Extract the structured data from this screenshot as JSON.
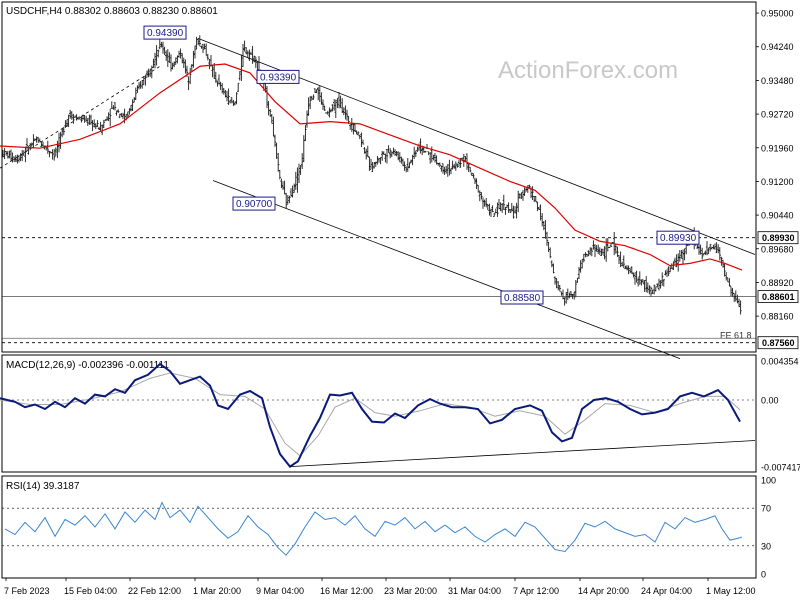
{
  "header": {
    "symbol_line": "USDCHF,H4  0.88302 0.88603 0.88230 0.88601"
  },
  "watermark": "ActionForex.com",
  "colors": {
    "candle": "#1a1a1a",
    "ma": "#e00000",
    "macd_line": "#0a1a7a",
    "macd_signal": "#a8a8a8",
    "rsi": "#3a86d4",
    "label_box": "#1a1a8c",
    "watermark": "#c8c8c8"
  },
  "chart_data": [
    {
      "type": "candlestick",
      "name": "price",
      "ylim": [
        0.8735,
        0.9525
      ],
      "y_ticks": [
        "0.95000",
        "0.94240",
        "0.93480",
        "0.92720",
        "0.91960",
        "0.91200",
        "0.90440",
        "0.89680",
        "0.88920",
        "0.88160"
      ],
      "x_ticks": [
        "7 Feb 2023",
        "15 Feb 04:00",
        "22 Feb 12:00",
        "1 Mar 20:00",
        "9 Mar 04:00",
        "16 Mar 12:00",
        "23 Mar 20:00",
        "31 Mar 04:00",
        "7 Apr 12:00",
        "14 Apr 20:00",
        "24 Apr 04:00",
        "1 May 12:00"
      ],
      "path_points": [
        [
          0,
          0.919
        ],
        [
          18,
          0.917
        ],
        [
          38,
          0.9215
        ],
        [
          56,
          0.918
        ],
        [
          70,
          0.927
        ],
        [
          90,
          0.9255
        ],
        [
          102,
          0.924
        ],
        [
          115,
          0.929
        ],
        [
          127,
          0.926
        ],
        [
          140,
          0.933
        ],
        [
          152,
          0.938
        ],
        [
          163,
          0.943
        ],
        [
          172,
          0.938
        ],
        [
          182,
          0.941
        ],
        [
          190,
          0.935
        ],
        [
          198,
          0.9439
        ],
        [
          206,
          0.942
        ],
        [
          215,
          0.936
        ],
        [
          225,
          0.932
        ],
        [
          236,
          0.929
        ],
        [
          245,
          0.942
        ],
        [
          256,
          0.94
        ],
        [
          265,
          0.9339
        ],
        [
          273,
          0.926
        ],
        [
          281,
          0.913
        ],
        [
          288,
          0.907
        ],
        [
          295,
          0.911
        ],
        [
          303,
          0.916
        ],
        [
          310,
          0.93
        ],
        [
          318,
          0.933
        ],
        [
          328,
          0.927
        ],
        [
          340,
          0.93
        ],
        [
          352,
          0.925
        ],
        [
          362,
          0.922
        ],
        [
          372,
          0.915
        ],
        [
          383,
          0.918
        ],
        [
          395,
          0.919
        ],
        [
          408,
          0.915
        ],
        [
          420,
          0.92
        ],
        [
          432,
          0.918
        ],
        [
          444,
          0.915
        ],
        [
          456,
          0.915
        ],
        [
          466,
          0.9175
        ],
        [
          476,
          0.912
        ],
        [
          486,
          0.907
        ],
        [
          495,
          0.9045
        ],
        [
          505,
          0.907
        ],
        [
          515,
          0.9045
        ],
        [
          522,
          0.909
        ],
        [
          530,
          0.911
        ],
        [
          540,
          0.906
        ],
        [
          549,
          0.898
        ],
        [
          556,
          0.89
        ],
        [
          565,
          0.8858
        ],
        [
          575,
          0.887
        ],
        [
          584,
          0.8945
        ],
        [
          594,
          0.897
        ],
        [
          604,
          0.896
        ],
        [
          614,
          0.898
        ],
        [
          624,
          0.893
        ],
        [
          634,
          0.891
        ],
        [
          644,
          0.889
        ],
        [
          654,
          0.887
        ],
        [
          664,
          0.89
        ],
        [
          674,
          0.893
        ],
        [
          684,
          0.896
        ],
        [
          694,
          0.8993
        ],
        [
          704,
          0.895
        ],
        [
          713,
          0.8975
        ],
        [
          720,
          0.8965
        ],
        [
          728,
          0.89
        ],
        [
          735,
          0.886
        ],
        [
          742,
          0.8835
        ]
      ],
      "moving_average": [
        [
          0,
          0.92
        ],
        [
          40,
          0.9195
        ],
        [
          80,
          0.9215
        ],
        [
          120,
          0.925
        ],
        [
          160,
          0.932
        ],
        [
          200,
          0.938
        ],
        [
          225,
          0.9385
        ],
        [
          250,
          0.9365
        ],
        [
          275,
          0.93
        ],
        [
          300,
          0.925
        ],
        [
          330,
          0.9255
        ],
        [
          360,
          0.925
        ],
        [
          390,
          0.9225
        ],
        [
          420,
          0.92
        ],
        [
          450,
          0.918
        ],
        [
          480,
          0.915
        ],
        [
          510,
          0.912
        ],
        [
          535,
          0.91
        ],
        [
          555,
          0.906
        ],
        [
          575,
          0.901
        ],
        [
          600,
          0.8985
        ],
        [
          625,
          0.8975
        ],
        [
          650,
          0.8955
        ],
        [
          670,
          0.893
        ],
        [
          690,
          0.8935
        ],
        [
          710,
          0.8945
        ],
        [
          725,
          0.8935
        ],
        [
          742,
          0.892
        ]
      ],
      "channel_upper": [
        [
          198,
          0.9443
        ],
        [
          755,
          0.8955
        ]
      ],
      "channel_lower": [
        [
          213,
          0.9122
        ],
        [
          680,
          0.872
        ]
      ],
      "trend_support": [
        [
          0,
          0.915
        ],
        [
          160,
          0.938
        ]
      ],
      "horizontal_levels": [
        {
          "value": 0.8993,
          "label": "0.89930",
          "style": "dashed"
        },
        {
          "value": 0.88601,
          "label": "0.88601",
          "style": "solid"
        },
        {
          "value": 0.8756,
          "label": "0.87560",
          "style": "dashed"
        },
        {
          "value": 0.8766,
          "style": "solid"
        }
      ],
      "price_labels": [
        {
          "text": "0.94390",
          "x": 165,
          "value": 0.9439
        },
        {
          "text": "0.93390",
          "x": 278,
          "value": 0.9339
        },
        {
          "text": "0.90700",
          "x": 254,
          "value": 0.907
        },
        {
          "text": "0.88580",
          "x": 522,
          "value": 0.8858
        },
        {
          "text": "0.89930",
          "x": 678,
          "value": 0.8993
        }
      ],
      "annotations": [
        {
          "text": "FE 61.8"
        }
      ]
    },
    {
      "type": "line",
      "name": "macd",
      "title": "MACD(12,26,9) -0.002396 -0.001111",
      "ylim": [
        -0.008,
        0.005
      ],
      "y_ticks": [
        "0.004354",
        "0.00",
        "-0.007417"
      ],
      "macd": [
        [
          0,
          0.0002
        ],
        [
          15,
          -0.0002
        ],
        [
          25,
          -0.0008
        ],
        [
          35,
          -0.0005
        ],
        [
          45,
          -0.001
        ],
        [
          55,
          -0.0002
        ],
        [
          65,
          -0.0008
        ],
        [
          75,
          0.0002
        ],
        [
          85,
          -0.0004
        ],
        [
          95,
          0.0006
        ],
        [
          105,
          0.0004
        ],
        [
          115,
          0.0012
        ],
        [
          125,
          0.0008
        ],
        [
          135,
          0.0022
        ],
        [
          148,
          0.0028
        ],
        [
          160,
          0.004
        ],
        [
          170,
          0.0032
        ],
        [
          180,
          0.0018
        ],
        [
          190,
          0.0022
        ],
        [
          200,
          0.0026
        ],
        [
          210,
          0.0016
        ],
        [
          218,
          -0.0006
        ],
        [
          228,
          -0.001
        ],
        [
          240,
          0.0006
        ],
        [
          250,
          0.001
        ],
        [
          262,
          0.0002
        ],
        [
          270,
          -0.003
        ],
        [
          280,
          -0.006
        ],
        [
          290,
          -0.0074
        ],
        [
          298,
          -0.0068
        ],
        [
          310,
          -0.004
        ],
        [
          320,
          -0.002
        ],
        [
          330,
          0.0006
        ],
        [
          340,
          0.0005
        ],
        [
          352,
          0.0008
        ],
        [
          362,
          -0.001
        ],
        [
          372,
          -0.0024
        ],
        [
          384,
          -0.0025
        ],
        [
          395,
          -0.0015
        ],
        [
          405,
          -0.002
        ],
        [
          418,
          -0.0006
        ],
        [
          430,
          0.0001
        ],
        [
          440,
          -0.0004
        ],
        [
          452,
          -0.0008
        ],
        [
          465,
          -0.0008
        ],
        [
          478,
          -0.001
        ],
        [
          490,
          -0.0026
        ],
        [
          502,
          -0.0022
        ],
        [
          515,
          -0.001
        ],
        [
          530,
          -0.0006
        ],
        [
          542,
          -0.0012
        ],
        [
          552,
          -0.0036
        ],
        [
          562,
          -0.0046
        ],
        [
          572,
          -0.0042
        ],
        [
          582,
          -0.001
        ],
        [
          594,
          0.0
        ],
        [
          606,
          0.0002
        ],
        [
          618,
          -0.0002
        ],
        [
          630,
          -0.001
        ],
        [
          642,
          -0.0016
        ],
        [
          655,
          -0.0014
        ],
        [
          668,
          -0.001
        ],
        [
          680,
          0.0004
        ],
        [
          692,
          0.0008
        ],
        [
          704,
          0.0004
        ],
        [
          718,
          0.0011
        ],
        [
          728,
          0.0
        ],
        [
          740,
          -0.0024
        ]
      ],
      "signal": [
        [
          0,
          0.0
        ],
        [
          30,
          -0.0005
        ],
        [
          60,
          -0.0005
        ],
        [
          90,
          0.0001
        ],
        [
          120,
          0.0009
        ],
        [
          150,
          0.0024
        ],
        [
          170,
          0.003
        ],
        [
          195,
          0.0024
        ],
        [
          220,
          0.0006
        ],
        [
          245,
          0.0004
        ],
        [
          265,
          -0.001
        ],
        [
          285,
          -0.0048
        ],
        [
          300,
          -0.0062
        ],
        [
          318,
          -0.004
        ],
        [
          335,
          -0.0008
        ],
        [
          355,
          0.0002
        ],
        [
          375,
          -0.0014
        ],
        [
          395,
          -0.0018
        ],
        [
          420,
          -0.0012
        ],
        [
          445,
          -0.0004
        ],
        [
          470,
          -0.0008
        ],
        [
          495,
          -0.0018
        ],
        [
          520,
          -0.0012
        ],
        [
          545,
          -0.0018
        ],
        [
          565,
          -0.0038
        ],
        [
          585,
          -0.0022
        ],
        [
          605,
          -0.0004
        ],
        [
          630,
          -0.0006
        ],
        [
          655,
          -0.0014
        ],
        [
          680,
          -0.0004
        ],
        [
          705,
          0.0004
        ],
        [
          725,
          0.0004
        ],
        [
          740,
          -0.0011
        ]
      ],
      "trendline": [
        [
          290,
          -0.0074
        ],
        [
          755,
          -0.0045
        ]
      ]
    },
    {
      "type": "line",
      "name": "rsi",
      "title": "RSI(14) 39.3187",
      "ylim": [
        0,
        100
      ],
      "y_ticks": [
        "100",
        "70",
        "30",
        "0"
      ],
      "levels": [
        70,
        30
      ],
      "values": [
        [
          5,
          48
        ],
        [
          15,
          42
        ],
        [
          25,
          55
        ],
        [
          35,
          45
        ],
        [
          45,
          60
        ],
        [
          55,
          40
        ],
        [
          65,
          58
        ],
        [
          75,
          52
        ],
        [
          85,
          62
        ],
        [
          95,
          50
        ],
        [
          105,
          64
        ],
        [
          115,
          48
        ],
        [
          125,
          66
        ],
        [
          135,
          55
        ],
        [
          145,
          68
        ],
        [
          155,
          58
        ],
        [
          162,
          76
        ],
        [
          170,
          60
        ],
        [
          180,
          68
        ],
        [
          190,
          55
        ],
        [
          198,
          72
        ],
        [
          208,
          60
        ],
        [
          218,
          48
        ],
        [
          228,
          38
        ],
        [
          238,
          45
        ],
        [
          248,
          62
        ],
        [
          258,
          50
        ],
        [
          268,
          42
        ],
        [
          278,
          28
        ],
        [
          286,
          20
        ],
        [
          295,
          32
        ],
        [
          305,
          50
        ],
        [
          315,
          66
        ],
        [
          325,
          58
        ],
        [
          335,
          60
        ],
        [
          345,
          52
        ],
        [
          355,
          62
        ],
        [
          365,
          48
        ],
        [
          375,
          40
        ],
        [
          385,
          56
        ],
        [
          395,
          52
        ],
        [
          405,
          60
        ],
        [
          415,
          48
        ],
        [
          425,
          56
        ],
        [
          435,
          45
        ],
        [
          445,
          52
        ],
        [
          455,
          44
        ],
        [
          465,
          50
        ],
        [
          475,
          40
        ],
        [
          485,
          34
        ],
        [
          495,
          42
        ],
        [
          505,
          48
        ],
        [
          515,
          40
        ],
        [
          525,
          55
        ],
        [
          535,
          50
        ],
        [
          545,
          38
        ],
        [
          555,
          26
        ],
        [
          565,
          24
        ],
        [
          575,
          36
        ],
        [
          585,
          54
        ],
        [
          595,
          50
        ],
        [
          605,
          56
        ],
        [
          615,
          48
        ],
        [
          625,
          44
        ],
        [
          635,
          40
        ],
        [
          645,
          42
        ],
        [
          655,
          34
        ],
        [
          665,
          55
        ],
        [
          675,
          48
        ],
        [
          685,
          60
        ],
        [
          695,
          55
        ],
        [
          705,
          58
        ],
        [
          715,
          62
        ],
        [
          722,
          48
        ],
        [
          730,
          36
        ],
        [
          738,
          38
        ],
        [
          742,
          39.3
        ]
      ]
    }
  ]
}
